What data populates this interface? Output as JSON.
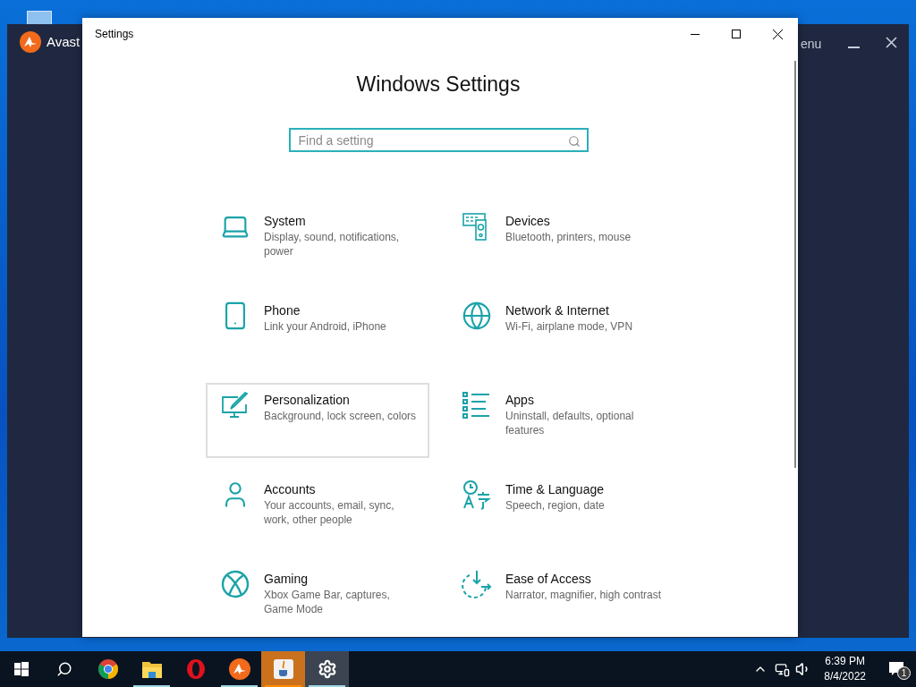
{
  "avast_window": {
    "brand": "Avast",
    "menu": "enu"
  },
  "settings_window": {
    "title": "Settings",
    "heading": "Windows Settings",
    "search": {
      "placeholder": "Find a setting"
    },
    "categories": [
      {
        "name": "System",
        "description": "Display, sound, notifications, power",
        "hovered": false
      },
      {
        "name": "Devices",
        "description": "Bluetooth, printers, mouse",
        "hovered": false
      },
      {
        "name": "Phone",
        "description": "Link your Android, iPhone",
        "hovered": false
      },
      {
        "name": "Network & Internet",
        "description": "Wi-Fi, airplane mode, VPN",
        "hovered": false
      },
      {
        "name": "Personalization",
        "description": "Background, lock screen, colors",
        "hovered": true
      },
      {
        "name": "Apps",
        "description": "Uninstall, defaults, optional features",
        "hovered": false
      },
      {
        "name": "Accounts",
        "description": "Your accounts, email, sync, work, other people",
        "hovered": false
      },
      {
        "name": "Time & Language",
        "description": "Speech, region, date",
        "hovered": false
      },
      {
        "name": "Gaming",
        "description": "Xbox Game Bar, captures, Game Mode",
        "hovered": false
      },
      {
        "name": "Ease of Access",
        "description": "Narrator, magnifier, high contrast",
        "hovered": false
      }
    ]
  },
  "taskbar": {
    "apps": [
      {
        "kind": "chrome",
        "running": false,
        "focused": false,
        "flashing": false
      },
      {
        "kind": "explorer",
        "running": true,
        "focused": false,
        "flashing": false
      },
      {
        "kind": "opera",
        "running": false,
        "focused": false,
        "flashing": false
      },
      {
        "kind": "avast",
        "running": true,
        "focused": false,
        "flashing": false
      },
      {
        "kind": "java",
        "running": true,
        "focused": false,
        "flashing": true
      },
      {
        "kind": "settings",
        "running": true,
        "focused": true,
        "flashing": false
      }
    ],
    "time": "6:39 PM",
    "date": "8/4/2022",
    "notification_count": "1"
  }
}
